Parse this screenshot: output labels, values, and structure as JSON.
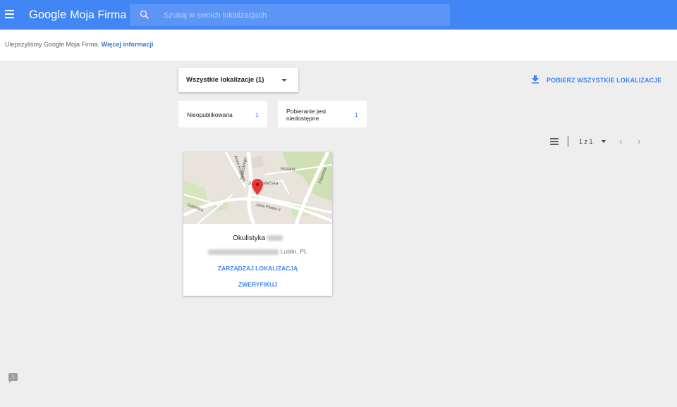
{
  "header": {
    "brand_google": "Google",
    "brand_product": "Moja Firma",
    "search_placeholder": "Szukaj w swoich lokalizacjach"
  },
  "notice": {
    "text": "Ulepszyliśmy Google Moja Firma.",
    "link": "Więcej informacji"
  },
  "filter": {
    "label": "Wszystkie lokalizacje (1)"
  },
  "download": {
    "label": "POBIERZ WSZYSTKIE LOKALIZACJE"
  },
  "stats": [
    {
      "label": "Nieopublikowana",
      "count": "1"
    },
    {
      "label_line1": "Pobieranie jest",
      "label_line2": "niedostępne",
      "count": "1"
    }
  ],
  "pager": {
    "text": "1 z 1"
  },
  "card": {
    "name": "Okulistyka",
    "address_city": "Lublin, PL",
    "manage_label": "ZARZĄDZAJ LOKALIZACJĄ",
    "verify_label": "ZWERYFIKUJ",
    "map_labels": {
      "street1": "Sobieskiego",
      "street2": "Armii Krajowej",
      "street3": "Różana",
      "street4": "Jugosłowiańska",
      "street5": "Filaretów",
      "street6": "Gdańska",
      "street7": "Jana Pawła II"
    }
  },
  "colors": {
    "brand": "#4285f4",
    "background": "#eeeeee",
    "pin": "#e53935"
  },
  "icons": [
    "menu-icon",
    "search-icon",
    "caret-down-icon",
    "download-icon",
    "list-view-icon",
    "chevron-left-icon",
    "chevron-right-icon",
    "map-pin-icon",
    "feedback-icon"
  ]
}
